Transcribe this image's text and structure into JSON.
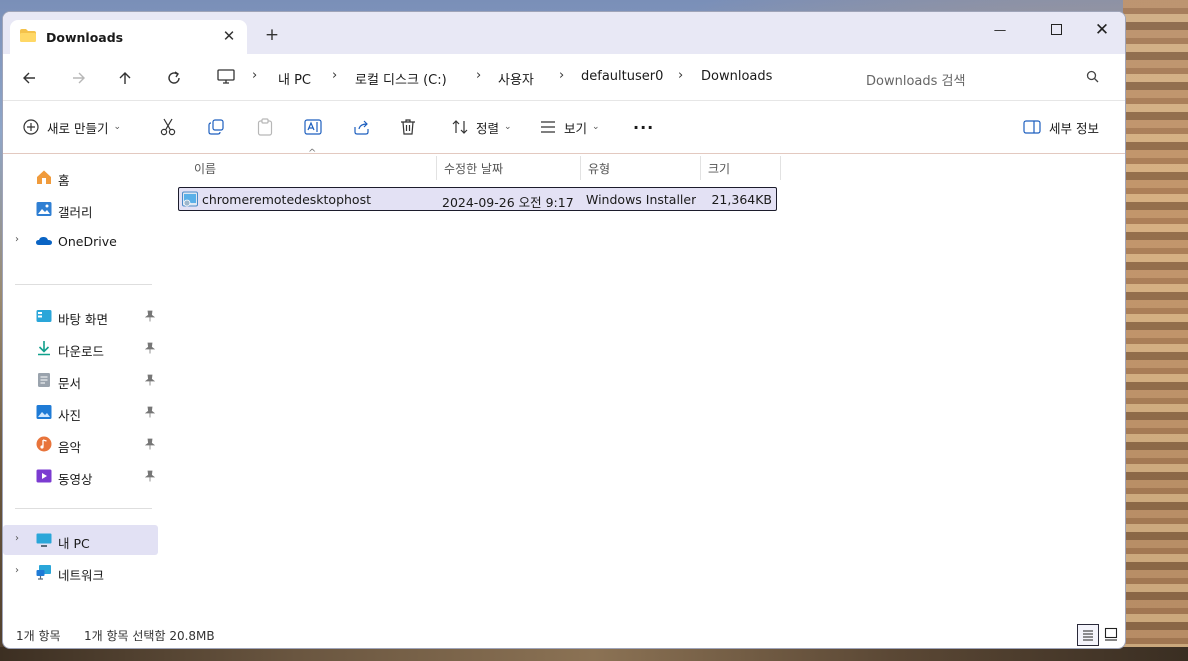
{
  "window": {
    "tab_title": "Downloads",
    "close_tab": "✕",
    "new_tab": "+",
    "minimize": "—",
    "close": "✕"
  },
  "address": {
    "crumbs": [
      "내 PC",
      "로컬 디스크 (C:)",
      "사용자",
      "defaultuser0",
      "Downloads"
    ],
    "search_placeholder": "Downloads 검색"
  },
  "toolbar": {
    "new_label": "새로 만들기",
    "sort_label": "정렬",
    "view_label": "보기",
    "more": "···",
    "details_label": "세부 정보"
  },
  "sidebar": {
    "top": [
      {
        "label": "홈",
        "icon": "home-icon"
      },
      {
        "label": "갤러리",
        "icon": "gallery-icon"
      },
      {
        "label": "OneDrive",
        "icon": "onedrive-icon",
        "expandable": true
      }
    ],
    "pinned": [
      {
        "label": "바탕 화면",
        "icon": "desktop-icon"
      },
      {
        "label": "다운로드",
        "icon": "download-icon"
      },
      {
        "label": "문서",
        "icon": "documents-icon"
      },
      {
        "label": "사진",
        "icon": "pictures-icon"
      },
      {
        "label": "음악",
        "icon": "music-icon"
      },
      {
        "label": "동영상",
        "icon": "videos-icon"
      }
    ],
    "bottom": [
      {
        "label": "내 PC",
        "icon": "pc-icon",
        "selected": true
      },
      {
        "label": "네트워크",
        "icon": "network-icon"
      }
    ]
  },
  "columns": {
    "name": "이름",
    "modified": "수정한 날짜",
    "type": "유형",
    "size": "크기"
  },
  "files": [
    {
      "name": "chromeremotedesktophost",
      "modified": "2024-09-26 오전 9:17",
      "type": "Windows Installer...",
      "size": "21,364KB",
      "selected": true
    }
  ],
  "status": {
    "count": "1개 항목",
    "selection": "1개 항목 선택함 20.8MB"
  },
  "colors": {
    "accent": "#0067c0",
    "selection_bg": "#e3e1f4",
    "titlebar_bg": "#e8e8f5"
  }
}
